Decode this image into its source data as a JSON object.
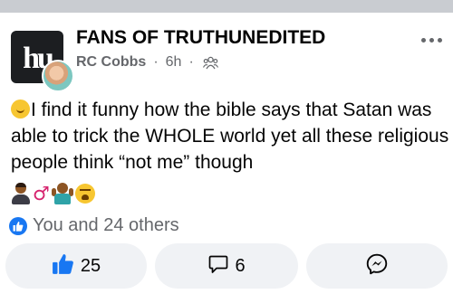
{
  "post": {
    "group_name": "FANS OF TRUTHUNEDITED",
    "group_avatar_text": "hu",
    "author": "RC Cobbs",
    "separator": "·",
    "time": "6h",
    "privacy_icon": "group-privacy-icon",
    "text": "I find it funny how the bible says that Satan was able to trick the WHOLE world yet all these religious people think “not me” though",
    "lead_emoji": "grinning-face-with-hand-over-mouth",
    "trailing_emojis": [
      "man-with-hair",
      "male-sign",
      "shrugging-person",
      "weary-face"
    ],
    "male_sign": "♂"
  },
  "reactions": {
    "text": "You and 24 others",
    "icon": "like-reaction-icon"
  },
  "actions": {
    "like_count": "25",
    "comment_count": "6",
    "share_icon": "messenger-icon"
  },
  "colors": {
    "accent": "#1877f2",
    "secondary_text": "#65676b",
    "pill_bg": "#f0f2f5",
    "top_band": "#c9ccd1"
  }
}
